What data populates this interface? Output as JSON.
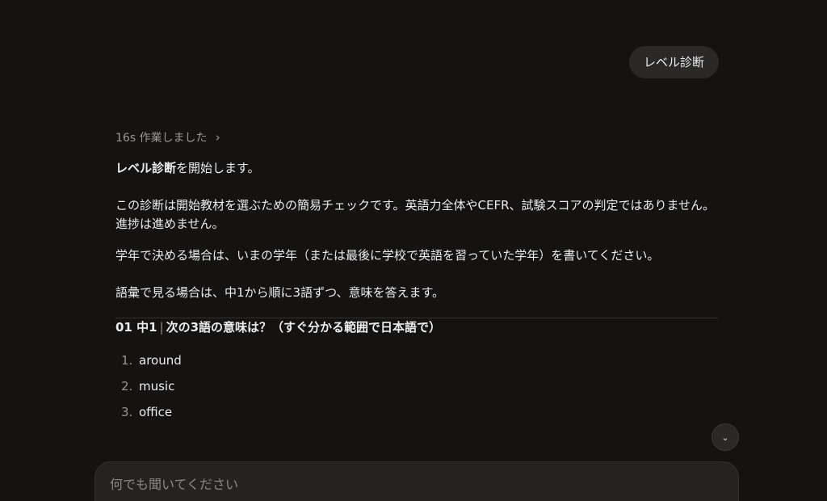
{
  "user_message": "レベル診断",
  "work_status": {
    "label": "16s 作業しました",
    "chevron": "›"
  },
  "assistant": {
    "line1_bold": "レベル診断",
    "line1_rest": "を開始します。",
    "para2": "この診断は開始教材を選ぶための簡易チェックです。英語力全体やCEFR、試験スコアの判定ではありません。進捗は進めません。",
    "para3": "学年で決める場合は、いまの学年（または最後に学校で英語を習っていた学年）を書いてください。",
    "para4": "語彙で見る場合は、中1から順に3語ずつ、意味を答えます。",
    "question": {
      "code": "01 中1",
      "separator": "|",
      "text": "次の3語の意味は？（すぐ分かる範囲で日本語で）"
    },
    "words": [
      {
        "num": "1.",
        "word": "around"
      },
      {
        "num": "2.",
        "word": "music"
      },
      {
        "num": "3.",
        "word": "office"
      }
    ]
  },
  "scroll_button": {
    "icon": "chevron-down-icon",
    "glyph": "⌄"
  },
  "composer": {
    "placeholder": "何でも聞いてください"
  }
}
